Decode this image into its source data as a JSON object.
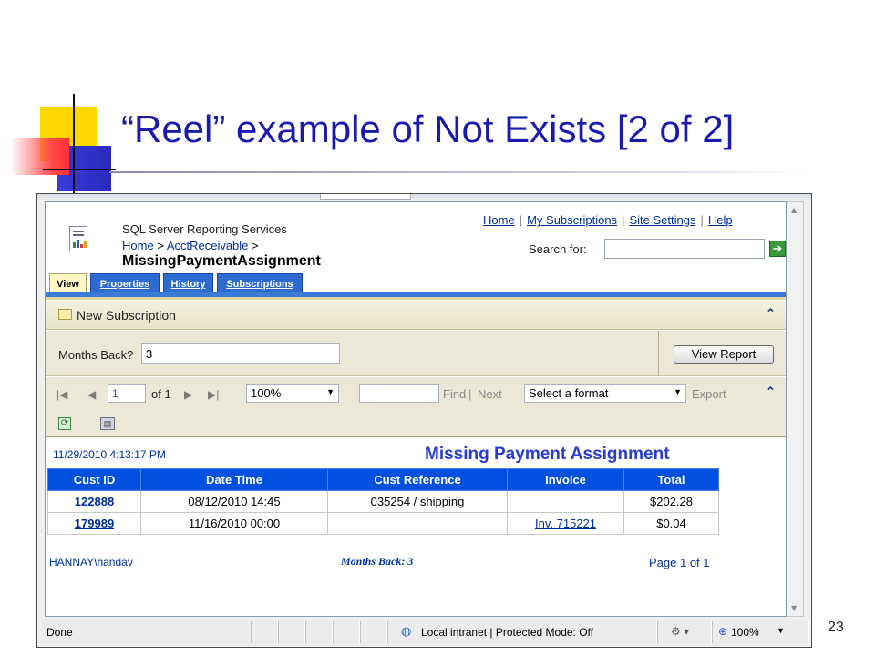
{
  "slide": {
    "title": "“Reel” example of Not Exists  [2 of 2]",
    "page_number": "23"
  },
  "header": {
    "service_name": "SQL Server Reporting Services",
    "breadcrumb": {
      "home": "Home",
      "sep1": ">",
      "folder": "AcctReceivable",
      "sep2": ">"
    },
    "report_name": "MissingPaymentAssignment",
    "links": [
      "Home",
      "My Subscriptions",
      "Site Settings",
      "Help"
    ],
    "link_separator": "|",
    "search_label": "Search for:",
    "search_value": ""
  },
  "tabs": [
    {
      "label": "View",
      "active": true
    },
    {
      "label": "Properties",
      "active": false
    },
    {
      "label": "History",
      "active": false
    },
    {
      "label": "Subscriptions",
      "active": false
    }
  ],
  "subscription_bar": {
    "label": "New Subscription",
    "collapse_glyph": "⌃"
  },
  "parameters": {
    "months_back_label": "Months Back?",
    "months_back_value": "3",
    "view_report_label": "View Report"
  },
  "toolbar": {
    "page_value": "1",
    "of_pages": "of 1",
    "zoom": "100%",
    "find_value": "",
    "find_label": "Find",
    "find_sep": "|",
    "next_label": "Next",
    "format_placeholder": "Select a format",
    "export_label": "Export"
  },
  "report": {
    "timestamp": "11/29/2010 4:13:17 PM",
    "title": "Missing Payment Assignment",
    "columns": [
      "Cust ID",
      "Date Time",
      "Cust Reference",
      "Invoice",
      "Total"
    ],
    "rows": [
      {
        "cust_id": "122888",
        "date_time": "08/12/2010 14:45",
        "cust_reference": "035254 / shipping",
        "invoice": "",
        "total": "$202.28"
      },
      {
        "cust_id": "179989",
        "date_time": "11/16/2010 00:00",
        "cust_reference": "",
        "invoice": "Inv. 715221",
        "total": "$0.04"
      }
    ],
    "user": "HANNAY\\handav",
    "months_back_footer": "Months Back: 3",
    "page_footer": "Page 1 of 1"
  },
  "statusbar": {
    "status": "Done",
    "zone": "Local intranet | Protected Mode: Off",
    "zoom": "100%"
  },
  "colors": {
    "slide_title": "#1a1ab0",
    "tab_blue": "#2d6bd0",
    "grid_header": "#0050e0",
    "report_title": "#2a3cd0",
    "link": "#00309c"
  }
}
